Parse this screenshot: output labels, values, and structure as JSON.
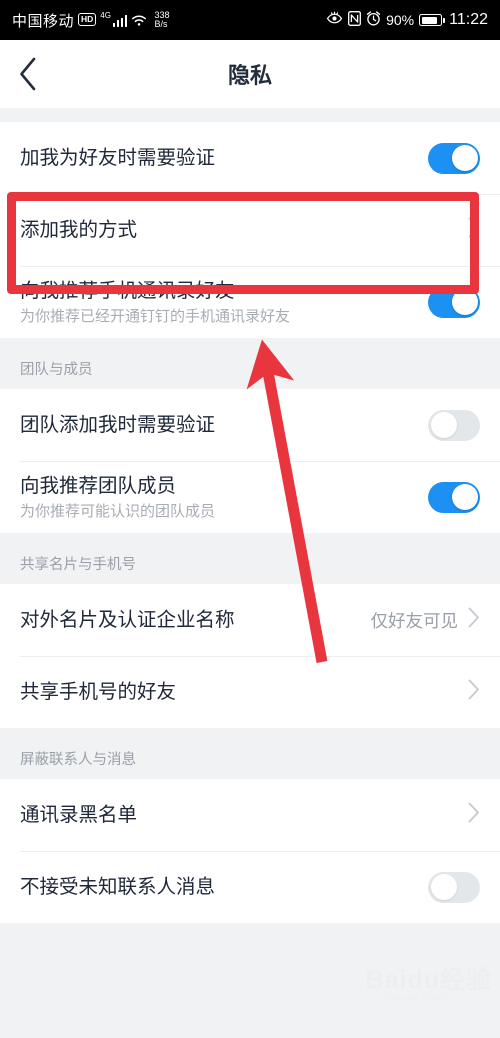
{
  "status_bar": {
    "carrier": "中国移动",
    "hd_badge": "HD",
    "network": "4G",
    "data_speed_value": "338",
    "data_speed_unit": "B/s",
    "eye_icon": "eye-off-icon",
    "nfc_icon": "nfc-icon",
    "alarm_icon": "alarm-clock-icon",
    "battery_percent": "90%",
    "time": "11:22"
  },
  "header": {
    "back_icon": "back-chevron-icon",
    "title": "隐私"
  },
  "sections": [
    {
      "header": "",
      "rows": [
        {
          "title": "加我为好友时需要验证",
          "sub": "",
          "control": "switch",
          "state": "on"
        },
        {
          "title": "添加我的方式",
          "sub": "",
          "control": "chevron",
          "value": ""
        },
        {
          "title": "向我推荐手机通讯录好友",
          "sub": "为你推荐已经开通钉钉的手机通讯录好友",
          "control": "switch",
          "state": "on"
        }
      ]
    },
    {
      "header": "团队与成员",
      "rows": [
        {
          "title": "团队添加我时需要验证",
          "sub": "",
          "control": "switch",
          "state": "off"
        },
        {
          "title": "向我推荐团队成员",
          "sub": "为你推荐可能认识的团队成员",
          "control": "switch",
          "state": "on"
        }
      ]
    },
    {
      "header": "共享名片与手机号",
      "rows": [
        {
          "title": "对外名片及认证企业名称",
          "sub": "",
          "control": "chevron",
          "value": "仅好友可见"
        },
        {
          "title": "共享手机号的好友",
          "sub": "",
          "control": "chevron",
          "value": ""
        }
      ]
    },
    {
      "header": "屏蔽联系人与消息",
      "rows": [
        {
          "title": "通讯录黑名单",
          "sub": "",
          "control": "chevron",
          "value": ""
        },
        {
          "title": "不接受未知联系人消息",
          "sub": "",
          "control": "switch",
          "state": "off"
        }
      ]
    }
  ],
  "annotations": {
    "highlight_color": "#e8353e",
    "rectangle_target": "添加我的方式",
    "arrow_target": "向我推荐手机通讯录好友"
  },
  "watermark": {
    "main": "Baidu经验",
    "sub": "jingyan.baidu.com"
  }
}
